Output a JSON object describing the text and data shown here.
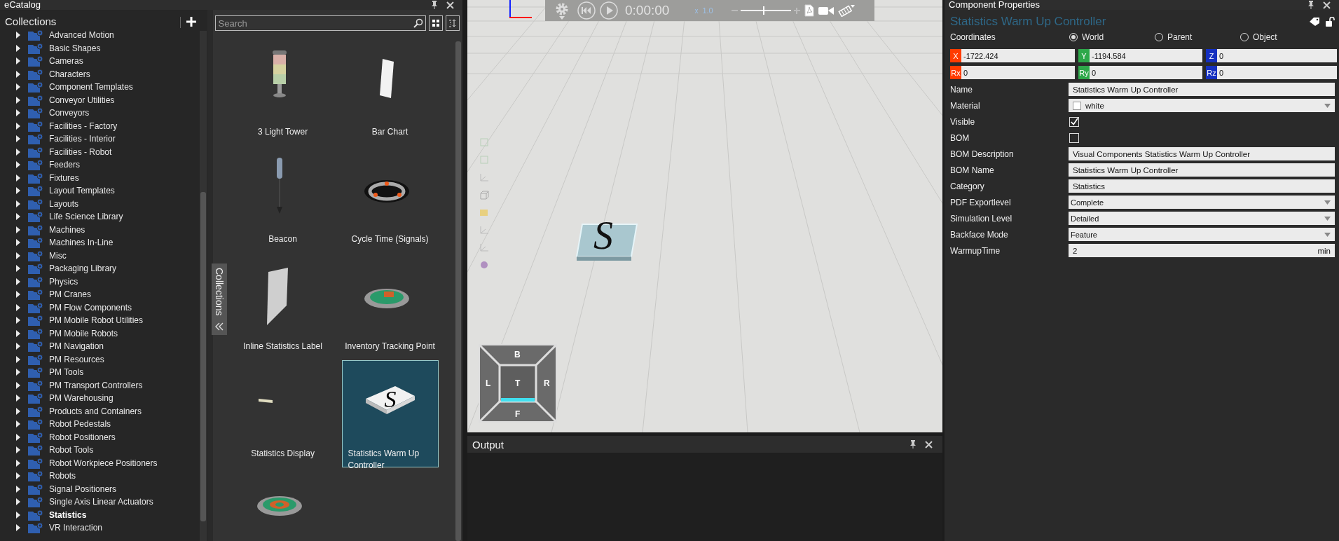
{
  "catalog": {
    "title": "eCatalog",
    "collections_label": "Collections",
    "collections": [
      {
        "label": "Advanced Motion",
        "selected": false
      },
      {
        "label": "Basic Shapes",
        "selected": false
      },
      {
        "label": "Cameras",
        "selected": false
      },
      {
        "label": "Characters",
        "selected": false
      },
      {
        "label": "Component Templates",
        "selected": false
      },
      {
        "label": "Conveyor Utilities",
        "selected": false
      },
      {
        "label": "Conveyors",
        "selected": false
      },
      {
        "label": "Facilities - Factory",
        "selected": false
      },
      {
        "label": "Facilities - Interior",
        "selected": false
      },
      {
        "label": "Facilities - Robot",
        "selected": false
      },
      {
        "label": "Feeders",
        "selected": false
      },
      {
        "label": "Fixtures",
        "selected": false
      },
      {
        "label": "Layout Templates",
        "selected": false
      },
      {
        "label": "Layouts",
        "selected": false
      },
      {
        "label": "Life Science Library",
        "selected": false
      },
      {
        "label": "Machines",
        "selected": false
      },
      {
        "label": "Machines In-Line",
        "selected": false
      },
      {
        "label": "Misc",
        "selected": false
      },
      {
        "label": "Packaging Library",
        "selected": false
      },
      {
        "label": "Physics",
        "selected": false
      },
      {
        "label": "PM Cranes",
        "selected": false
      },
      {
        "label": "PM Flow Components",
        "selected": false
      },
      {
        "label": "PM Mobile Robot Utilities",
        "selected": false
      },
      {
        "label": "PM Mobile Robots",
        "selected": false
      },
      {
        "label": "PM Navigation",
        "selected": false
      },
      {
        "label": "PM Resources",
        "selected": false
      },
      {
        "label": "PM Tools",
        "selected": false
      },
      {
        "label": "PM Transport Controllers",
        "selected": false
      },
      {
        "label": "PM Warehousing",
        "selected": false
      },
      {
        "label": "Products and Containers",
        "selected": false
      },
      {
        "label": "Robot Pedestals",
        "selected": false
      },
      {
        "label": "Robot Positioners",
        "selected": false
      },
      {
        "label": "Robot Tools",
        "selected": false
      },
      {
        "label": "Robot Workpiece Positioners",
        "selected": false
      },
      {
        "label": "Robots",
        "selected": false
      },
      {
        "label": "Signal Positioners",
        "selected": false
      },
      {
        "label": "Single Axis Linear Actuators",
        "selected": false
      },
      {
        "label": "Statistics",
        "selected": true
      },
      {
        "label": "VR Interaction",
        "selected": false
      }
    ],
    "search": {
      "placeholder": "Search"
    },
    "collections_tab": "Collections",
    "items": [
      {
        "kind": "light-tower",
        "label": "3 Light Tower",
        "selected": false
      },
      {
        "kind": "bar-chart",
        "label": "Bar Chart",
        "selected": false
      },
      {
        "kind": "beacon",
        "label": "Beacon",
        "selected": false
      },
      {
        "kind": "cycle-ring",
        "label": "Cycle Time (Signals)",
        "selected": false
      },
      {
        "kind": "label-panel",
        "label": "Inline Statistics Label",
        "selected": false
      },
      {
        "kind": "tracking-disc",
        "label": "Inventory Tracking Point",
        "selected": false
      },
      {
        "kind": "display",
        "label": "Statistics Display",
        "selected": false
      },
      {
        "kind": "s-tile",
        "mark": "S",
        "label": "Statistics Warm Up Controller",
        "selected": true
      },
      {
        "kind": "target-disc",
        "selected": false
      }
    ]
  },
  "viewport": {
    "time": "0:00:00",
    "speed_prefix": "x",
    "speed": "1.0",
    "speed_slider": {
      "level": 0.45
    },
    "object_mark": "S",
    "cube": {
      "top": "B",
      "left": "L",
      "center": "T",
      "right": "R",
      "bottom": "F"
    }
  },
  "output": {
    "title": "Output"
  },
  "properties": {
    "title": "Component Properties",
    "component": "Statistics Warm Up Controller",
    "coordinates_label": "Coordinates",
    "frames": [
      {
        "label": "World",
        "selected": true
      },
      {
        "label": "Parent",
        "selected": false
      },
      {
        "label": "Object",
        "selected": false
      }
    ],
    "coords": [
      {
        "axis": "X",
        "value": "-1722.424",
        "color": "#ff3c00"
      },
      {
        "axis": "Y",
        "value": "-1194.584",
        "color": "#2ea84a"
      },
      {
        "axis": "Z",
        "value": "0",
        "color": "#1530c0"
      },
      {
        "axis": "Rx",
        "value": "0",
        "color": "#ff3c00"
      },
      {
        "axis": "Ry",
        "value": "0",
        "color": "#2ea84a"
      },
      {
        "axis": "Rz",
        "value": "0",
        "color": "#1530c0"
      }
    ],
    "fields": [
      {
        "kind": "text",
        "label": "Name",
        "value": "Statistics Warm Up Controller"
      },
      {
        "kind": "material",
        "label": "Material",
        "value": "white"
      },
      {
        "kind": "check",
        "label": "Visible",
        "checked": true
      },
      {
        "kind": "check",
        "label": "BOM",
        "checked": false
      },
      {
        "kind": "text",
        "label": "BOM Description",
        "value": "Visual Components Statistics Warm Up Controller"
      },
      {
        "kind": "text",
        "label": "BOM Name",
        "value": "Statistics Warm Up Controller"
      },
      {
        "kind": "text",
        "label": "Category",
        "value": "Statistics"
      },
      {
        "kind": "dropdown",
        "label": "PDF Exportlevel",
        "value": "Complete"
      },
      {
        "kind": "dropdown",
        "label": "Simulation Level",
        "value": "Detailed"
      },
      {
        "kind": "dropdown",
        "label": "Backface Mode",
        "value": "Feature"
      },
      {
        "kind": "unit",
        "label": "WarmupTime",
        "value": "2",
        "unit": "min"
      }
    ]
  }
}
